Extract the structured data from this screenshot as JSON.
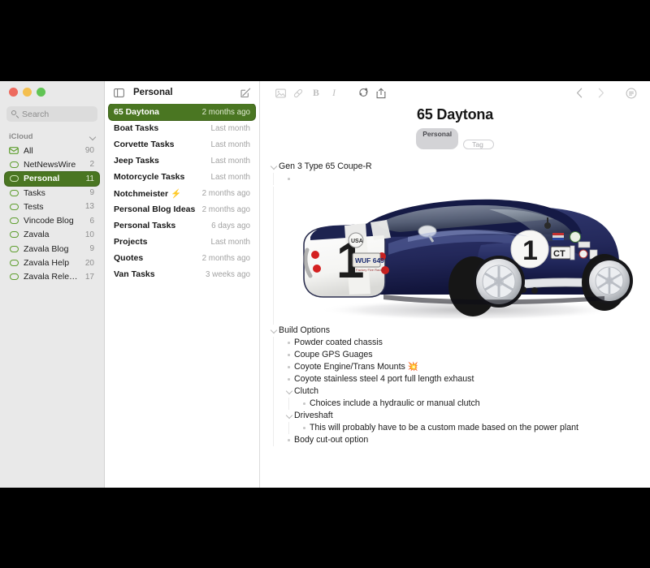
{
  "window": {
    "traffic_lights": [
      "close",
      "minimize",
      "zoom"
    ]
  },
  "sidebar": {
    "search": {
      "placeholder": "Search"
    },
    "section": {
      "label": "iCloud",
      "collapse_icon": "chevron-down-icon"
    },
    "items": [
      {
        "label": "All",
        "count": "90",
        "icon": "inbox-icon",
        "selected": false
      },
      {
        "label": "NetNewsWire",
        "count": "2",
        "icon": "oval-icon",
        "selected": false
      },
      {
        "label": "Personal",
        "count": "11",
        "icon": "oval-icon",
        "selected": true
      },
      {
        "label": "Tasks",
        "count": "9",
        "icon": "oval-icon",
        "selected": false
      },
      {
        "label": "Tests",
        "count": "13",
        "icon": "oval-icon",
        "selected": false
      },
      {
        "label": "Vincode Blog",
        "count": "6",
        "icon": "oval-icon",
        "selected": false
      },
      {
        "label": "Zavala",
        "count": "10",
        "icon": "oval-icon",
        "selected": false
      },
      {
        "label": "Zavala Blog",
        "count": "9",
        "icon": "oval-icon",
        "selected": false
      },
      {
        "label": "Zavala Help",
        "count": "20",
        "icon": "oval-icon",
        "selected": false
      },
      {
        "label": "Zavala Releases",
        "count": "17",
        "icon": "oval-icon",
        "selected": false
      }
    ]
  },
  "list": {
    "header": {
      "title": "Personal",
      "toggle_icon": "sidebar-toggle-icon",
      "compose_icon": "compose-icon"
    },
    "rows": [
      {
        "title": "65 Daytona",
        "date": "2 months ago",
        "selected": true
      },
      {
        "title": "Boat Tasks",
        "date": "Last month",
        "selected": false
      },
      {
        "title": "Corvette Tasks",
        "date": "Last month",
        "selected": false
      },
      {
        "title": "Jeep Tasks",
        "date": "Last month",
        "selected": false
      },
      {
        "title": "Motorcycle Tasks",
        "date": "Last month",
        "selected": false
      },
      {
        "title": "Notchmeister ⚡",
        "date": "2 months ago",
        "selected": false
      },
      {
        "title": "Personal Blog Ideas",
        "date": "2 months ago",
        "selected": false
      },
      {
        "title": "Personal Tasks",
        "date": "6 days ago",
        "selected": false
      },
      {
        "title": "Projects",
        "date": "Last month",
        "selected": false
      },
      {
        "title": "Quotes",
        "date": "2 months ago",
        "selected": false
      },
      {
        "title": "Van Tasks",
        "date": "3 weeks ago",
        "selected": false
      }
    ]
  },
  "toolbar": {
    "icons": [
      "insert-image-icon",
      "insert-link-icon",
      "bold-icon",
      "italic-icon",
      "tag-icon",
      "share-icon"
    ],
    "back_icon": "chevron-left-icon",
    "forward_icon": "chevron-right-icon",
    "format-menu_icon": "format-menu-icon"
  },
  "document": {
    "title": "65 Daytona",
    "tags": [
      {
        "label": "Personal",
        "style": "filled"
      },
      {
        "label": "Tag",
        "style": "outline"
      }
    ],
    "outline": [
      {
        "level": 1,
        "marker": "twisty",
        "text": "Gen 3 Type 65 Coupe-R"
      },
      {
        "level": 2,
        "marker": "bullet",
        "text": ""
      },
      {
        "level": 1,
        "marker": "twisty",
        "text": "Build Options"
      },
      {
        "level": 2,
        "marker": "bullet",
        "text": "Powder coated chassis"
      },
      {
        "level": 2,
        "marker": "bullet",
        "text": "Coupe GPS Guages"
      },
      {
        "level": 2,
        "marker": "bullet",
        "text": "Coyote Engine/Trans Mounts 💥"
      },
      {
        "level": 2,
        "marker": "bullet",
        "text": "Coyote stainless steel 4 port full length exhaust"
      },
      {
        "level": 2,
        "marker": "twisty",
        "text": "Clutch"
      },
      {
        "level": 3,
        "marker": "bullet",
        "text": "Choices include a hydraulic or manual clutch"
      },
      {
        "level": 2,
        "marker": "twisty",
        "text": "Driveshaft"
      },
      {
        "level": 3,
        "marker": "bullet",
        "text": "This will probably have to be a custom made based on the power plant"
      },
      {
        "level": 2,
        "marker": "bullet",
        "text": "Body cut-out option"
      }
    ],
    "image": {
      "alt": "Dark navy blue Shelby Daytona Coupe race car, rear three-quarter view, white rear panel with black number 1, license plate WUF 649",
      "body_color": "#23285a",
      "panel_color": "#f4f4f2",
      "number": "1",
      "plate": "WUF 649"
    }
  }
}
